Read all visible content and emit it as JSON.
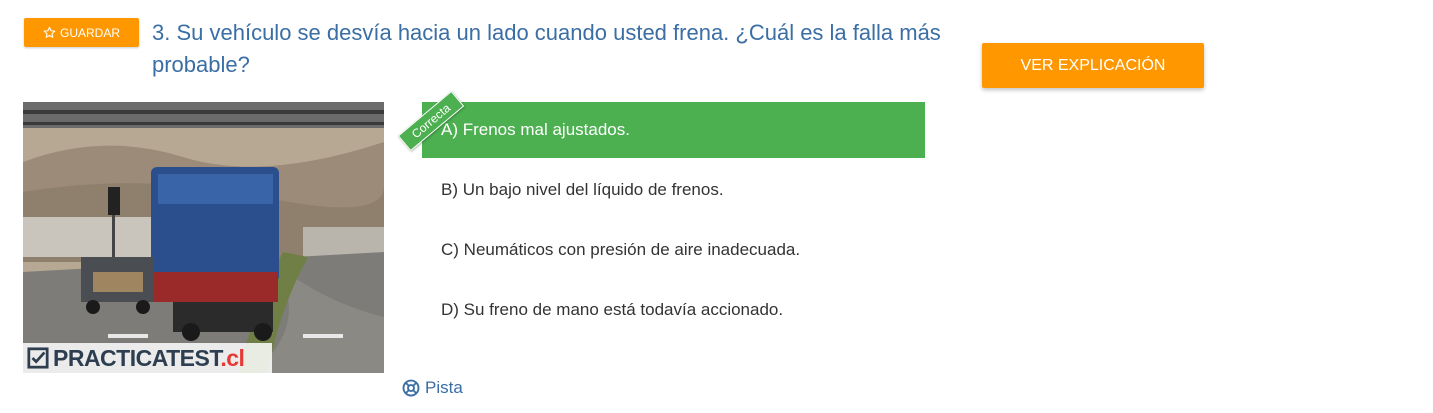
{
  "save_button": {
    "label": "GUARDAR",
    "icon": "star-outline-icon"
  },
  "question": {
    "number": "3.",
    "text": "3. Su vehículo se desvía hacia un lado cuando usted frena. ¿Cuál es la falla más probable?"
  },
  "explain_button": {
    "label": "VER EXPLICACIÓN"
  },
  "image": {
    "watermark_part1": "PRACTICA",
    "watermark_part2": "TEST",
    "watermark_part3": ".cl"
  },
  "correct_badge": "Correcta",
  "answers": [
    {
      "text": "A) Frenos mal ajustados.",
      "correct": true
    },
    {
      "text": "B) Un bajo nivel del líquido de frenos.",
      "correct": false
    },
    {
      "text": "C) Neumáticos con presión de aire inadecuada.",
      "correct": false
    },
    {
      "text": "D) Su freno de mano está todavía accionado.",
      "correct": false
    }
  ],
  "hint": {
    "label": "Pista",
    "icon": "lifebuoy-icon"
  },
  "colors": {
    "accent_orange": "#ff9800",
    "correct_green": "#4caf50",
    "link_blue": "#3a6ea5"
  }
}
